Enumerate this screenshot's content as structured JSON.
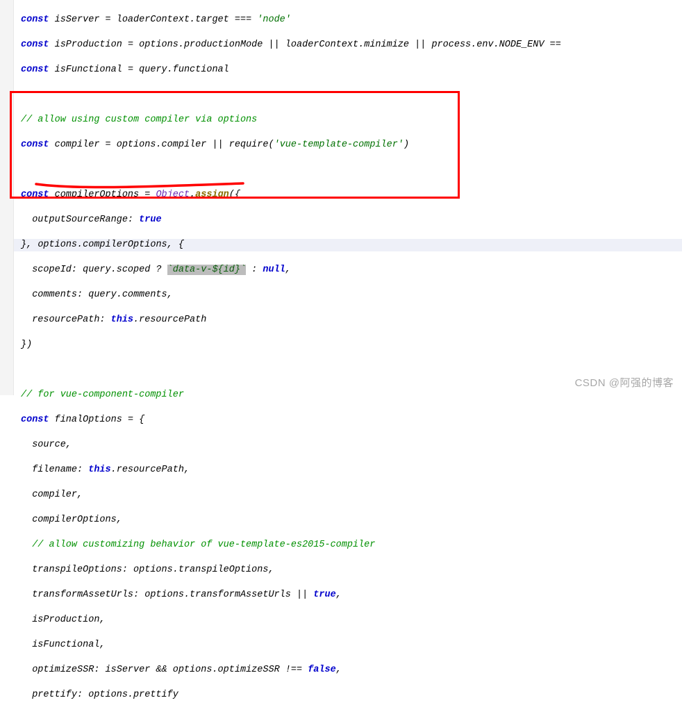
{
  "lines": {
    "l1": {
      "a": "const ",
      "b": "isServer ",
      "c": "= ",
      "d": "loaderContext.target ",
      "e": "=== ",
      "f": "'node'"
    },
    "l2": {
      "a": "const ",
      "b": "isProduction ",
      "c": "= ",
      "d": "options.productionMode ",
      "e": "|| ",
      "f": "loaderContext.minimize ",
      "g": "|| ",
      "h": "process.env.NODE_ENV ",
      "i": "=="
    },
    "l3": {
      "a": "const ",
      "b": "isFunctional ",
      "c": "= ",
      "d": "query.functional"
    },
    "l4": "",
    "l5": {
      "a": "// allow using custom compiler via options"
    },
    "l6": {
      "a": "const ",
      "b": "compiler ",
      "c": "= ",
      "d": "options.compiler ",
      "e": "|| ",
      "f": "require",
      "g": "(",
      "h": "'vue-template-compiler'",
      "i": ")"
    },
    "l7": "",
    "l8": {
      "a": "const ",
      "b": "compilerOptions ",
      "c": "= ",
      "d": "Object",
      "e": ".",
      "f": "assign",
      "g": "({"
    },
    "l9": {
      "a": "  outputSourceRange: ",
      "b": "true"
    },
    "l10": {
      "a": "}, ",
      "b": "options.compilerOptions, ",
      "c": "{"
    },
    "l11": {
      "a": "  scopeId: query.scoped ",
      "b": "? ",
      "c": "`data-v-${id}`",
      "d": " : ",
      "e": "null",
      "f": ","
    },
    "l12": {
      "a": "  comments: query.comments,"
    },
    "l13": {
      "a": "  resourcePath: ",
      "b": "this",
      "c": ".resourcePath"
    },
    "l14": {
      "a": "})"
    },
    "l15": "",
    "l16": {
      "a": "// for vue-component-compiler"
    },
    "l17": {
      "a": "const ",
      "b": "finalOptions ",
      "c": "= {"
    },
    "l18": {
      "a": "  source,"
    },
    "l19": {
      "a": "  filename: ",
      "b": "this",
      "c": ".resourcePath,"
    },
    "l20": {
      "a": "  compiler,"
    },
    "l21": {
      "a": "  compilerOptions,"
    },
    "l22": {
      "a": "  ",
      "b": "// allow customizing behavior of vue-template-es2015-compiler"
    },
    "l23": {
      "a": "  transpileOptions: options.transpileOptions,"
    },
    "l24": {
      "a": "  transformAssetUrls: options.transformAssetUrls ",
      "b": "|| ",
      "c": "true",
      "d": ","
    },
    "l25": {
      "a": "  isProduction,"
    },
    "l26": {
      "a": "  isFunctional,"
    },
    "l27": {
      "a": "  optimizeSSR: isServer ",
      "b": "&& ",
      "c": "options.optimizeSSR ",
      "d": "!== ",
      "e": "false",
      "f": ","
    },
    "l28": {
      "a": "  prettify: options.prettify"
    }
  },
  "watermark": "CSDN @阿强的博客",
  "chart_data": null
}
